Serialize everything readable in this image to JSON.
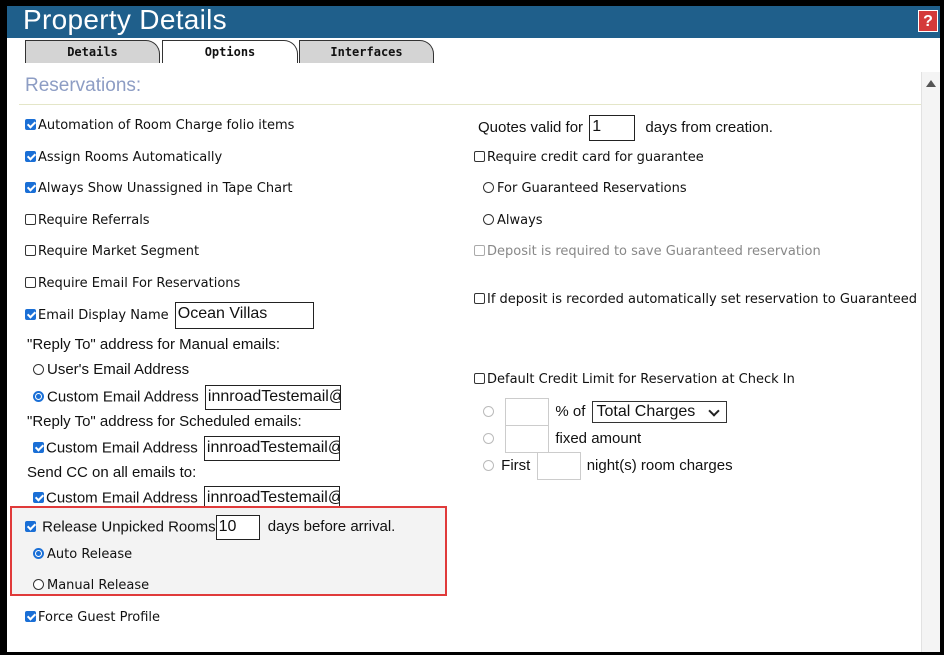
{
  "header": {
    "title": "Property Details",
    "help": "?"
  },
  "tabs": [
    {
      "label": "Details"
    },
    {
      "label": "Options"
    },
    {
      "label": "Interfaces"
    }
  ],
  "section": {
    "title": "Reservations:"
  },
  "left": {
    "automation": "Automation of Room Charge folio items",
    "assign_rooms": "Assign Rooms Automatically",
    "always_show": "Always Show Unassigned in Tape Chart",
    "require_referrals": "Require Referrals",
    "require_market": "Require Market Segment",
    "require_email": "Require Email For Reservations",
    "email_display_name": "Email Display Name",
    "email_display_value": "Ocean Villas",
    "reply_manual_label": "\"Reply To\" address for Manual emails:",
    "users_email": "User's Email Address",
    "custom_email": "Custom Email Address",
    "custom_email_value": "innroadTestemail@",
    "reply_scheduled_label": "\"Reply To\" address for Scheduled emails:",
    "send_cc_label": "Send CC on all emails to:",
    "release_unpicked": "Release Unpicked Rooms",
    "release_days": "10",
    "days_before": "days before arrival.",
    "auto_release": "Auto Release",
    "manual_release": "Manual Release",
    "force_guest": "Force Guest Profile"
  },
  "right": {
    "quotes_valid_for": "Quotes valid for",
    "quotes_value": "1",
    "days_from_creation": "days from creation.",
    "require_cc": "Require credit card for guarantee",
    "for_guaranteed": "For Guaranteed Reservations",
    "always": "Always",
    "deposit_required": "Deposit is required to save Guaranteed reservation",
    "deposit_auto": "If deposit is recorded automatically set reservation to Guaranteed",
    "default_credit": "Default Credit Limit for Reservation at Check In",
    "pct_of": "% of",
    "total_charges": "Total Charges",
    "fixed_amount": "fixed amount",
    "first": "First",
    "nights_room_charges": "night(s) room charges"
  },
  "colors": {
    "title_bar": "#1f5f8b",
    "accent": "#1a6fd6",
    "highlight_border": "#e03a3a"
  }
}
